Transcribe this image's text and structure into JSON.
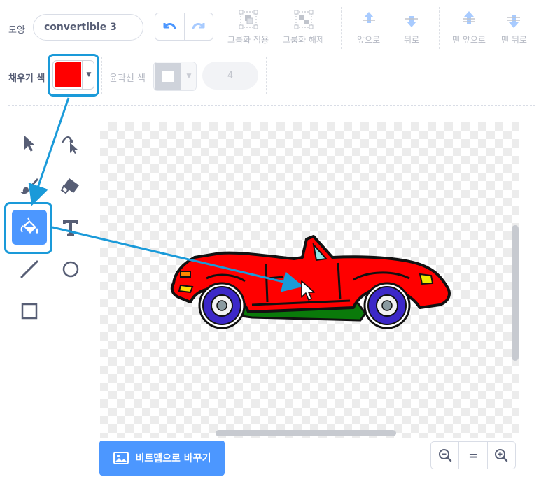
{
  "header": {
    "shape_label": "모양",
    "costume_name": "convertible 3"
  },
  "toolbar": {
    "undo_icon": "undo-icon",
    "redo_icon": "redo-icon",
    "group_label": "그룹화 적용",
    "ungroup_label": "그룹화 해제",
    "forward_label": "앞으로",
    "backward_label": "뒤로",
    "front_label": "맨 앞으로",
    "back_label": "맨 뒤로"
  },
  "fill": {
    "label": "채우기 색",
    "color": "#ff0000"
  },
  "outline": {
    "label": "윤곽선 색",
    "width": "4"
  },
  "tools": [
    {
      "name": "select",
      "icon": "select-arrow-icon"
    },
    {
      "name": "reshape",
      "icon": "reshape-icon"
    },
    {
      "name": "brush",
      "icon": "brush-icon"
    },
    {
      "name": "eraser",
      "icon": "eraser-icon"
    },
    {
      "name": "fill",
      "icon": "paint-bucket-icon",
      "selected": true
    },
    {
      "name": "text",
      "icon": "text-icon"
    },
    {
      "name": "line",
      "icon": "line-icon"
    },
    {
      "name": "circle",
      "icon": "circle-icon"
    },
    {
      "name": "rectangle",
      "icon": "rectangle-icon"
    }
  ],
  "bottom": {
    "bitmap_button_label": "비트맵으로 바꾸기",
    "zoom_out_icon": "zoom-out-icon",
    "zoom_reset_label": "=",
    "zoom_in_icon": "zoom-in-icon"
  },
  "colors": {
    "accent": "#4c97ff",
    "annotation": "#1a9ad9",
    "car_body": "#ff0000",
    "wheel_rim": "#3c28c8",
    "underbody": "#0a7a0a",
    "headlight": "#f0e800",
    "windshield": "#90e8e8"
  }
}
